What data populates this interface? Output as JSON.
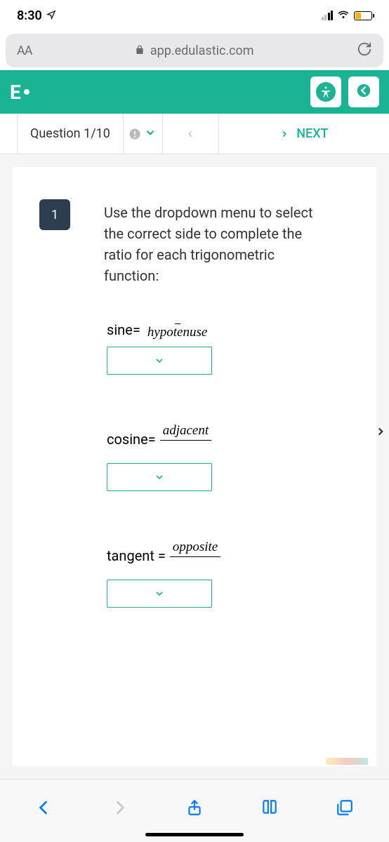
{
  "status": {
    "time": "8:30"
  },
  "browser": {
    "text_size": "AA",
    "url": "app.edulastic.com"
  },
  "app": {
    "logo": "E"
  },
  "nav": {
    "counter": "Question 1/10",
    "next_label": "NEXT"
  },
  "question": {
    "number": "1",
    "prompt": "Use the dropdown menu to select the correct side to complete the ratio for each trigonometric function:",
    "functions": [
      {
        "label": "sine=",
        "numerator": "",
        "denominator": "hypotenuse"
      },
      {
        "label": "cosine=",
        "numerator": "adjacent",
        "denominator": ""
      },
      {
        "label": "tangent =",
        "numerator": "opposite",
        "denominator": ""
      }
    ]
  }
}
